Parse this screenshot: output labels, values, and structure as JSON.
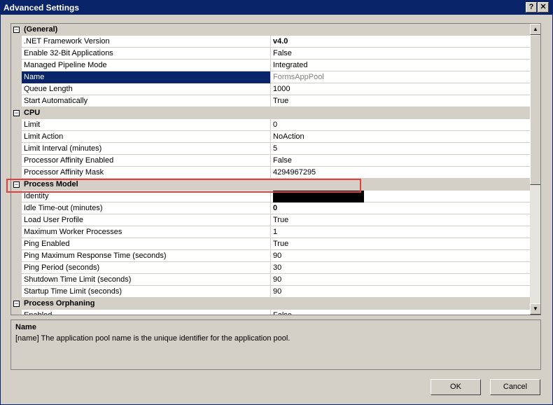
{
  "window": {
    "title": "Advanced Settings",
    "help_glyph": "?",
    "close_glyph": "✕"
  },
  "grid": {
    "rows": [
      {
        "kind": "cat",
        "label": "(General)"
      },
      {
        "kind": "prop",
        "name": ".NET Framework Version",
        "value": "v4.0",
        "style": "bold"
      },
      {
        "kind": "prop",
        "name": "Enable 32-Bit Applications",
        "value": "False"
      },
      {
        "kind": "prop",
        "name": "Managed Pipeline Mode",
        "value": "Integrated"
      },
      {
        "kind": "prop",
        "name": "Name",
        "value": "FormsAppPool",
        "style": "grey",
        "selected": true
      },
      {
        "kind": "prop",
        "name": "Queue Length",
        "value": "1000"
      },
      {
        "kind": "prop",
        "name": "Start Automatically",
        "value": "True"
      },
      {
        "kind": "cat",
        "label": "CPU"
      },
      {
        "kind": "prop",
        "name": "Limit",
        "value": "0"
      },
      {
        "kind": "prop",
        "name": "Limit Action",
        "value": "NoAction"
      },
      {
        "kind": "prop",
        "name": "Limit Interval (minutes)",
        "value": "5"
      },
      {
        "kind": "prop",
        "name": "Processor Affinity Enabled",
        "value": "False"
      },
      {
        "kind": "prop",
        "name": "Processor Affinity Mask",
        "value": "4294967295"
      },
      {
        "kind": "cat",
        "label": "Process Model"
      },
      {
        "kind": "prop",
        "name": "Identity",
        "value": "",
        "redacted": true
      },
      {
        "kind": "prop",
        "name": "Idle Time-out (minutes)",
        "value": "0",
        "style": "bold"
      },
      {
        "kind": "prop",
        "name": "Load User Profile",
        "value": "True"
      },
      {
        "kind": "prop",
        "name": "Maximum Worker Processes",
        "value": "1"
      },
      {
        "kind": "prop",
        "name": "Ping Enabled",
        "value": "True"
      },
      {
        "kind": "prop",
        "name": "Ping Maximum Response Time (seconds)",
        "value": "90"
      },
      {
        "kind": "prop",
        "name": "Ping Period (seconds)",
        "value": "30"
      },
      {
        "kind": "prop",
        "name": "Shutdown Time Limit (seconds)",
        "value": "90"
      },
      {
        "kind": "prop",
        "name": "Startup Time Limit (seconds)",
        "value": "90"
      },
      {
        "kind": "cat",
        "label": "Process Orphaning"
      },
      {
        "kind": "prop",
        "name": "Enabled",
        "value": "False"
      }
    ],
    "expander_glyph": "−"
  },
  "description": {
    "title": "Name",
    "text": "[name] The application pool name is the unique identifier for the application pool."
  },
  "buttons": {
    "ok": "OK",
    "cancel": "Cancel"
  },
  "scrollbar": {
    "up_glyph": "▲",
    "down_glyph": "▼"
  }
}
